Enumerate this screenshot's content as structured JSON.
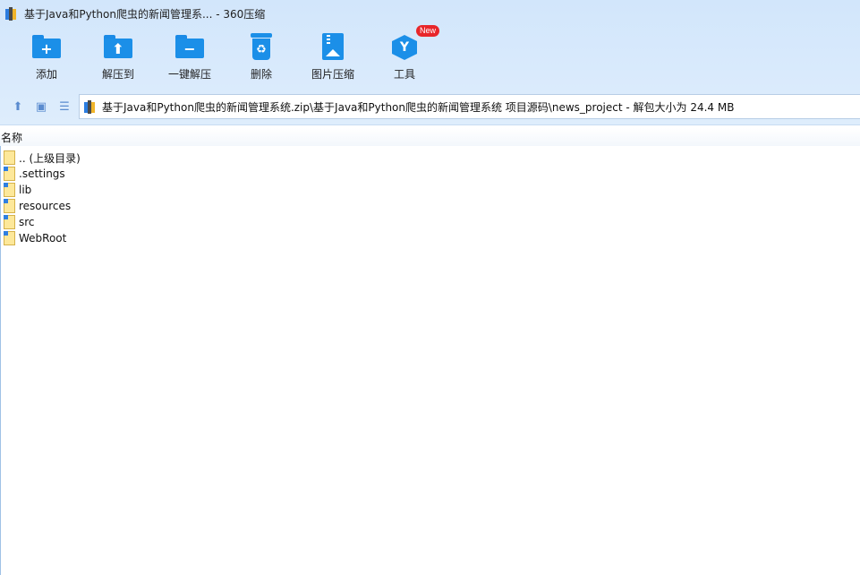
{
  "window": {
    "title": "基于Java和Python爬虫的新闻管理系... - 360压缩"
  },
  "toolbar": {
    "items": [
      {
        "label": "添加",
        "icon": "add-folder-icon"
      },
      {
        "label": "解压到",
        "icon": "extract-to-icon"
      },
      {
        "label": "一键解压",
        "icon": "one-click-extract-icon"
      },
      {
        "label": "删除",
        "icon": "recycle-bin-icon"
      },
      {
        "label": "图片压缩",
        "icon": "image-compress-icon"
      },
      {
        "label": "工具",
        "icon": "tools-icon",
        "badge": "New"
      }
    ]
  },
  "navbar": {
    "up_icon": "arrow-up-icon",
    "view_icon": "thumbnail-view-icon",
    "list_icon": "list-view-icon",
    "path": "基于Java和Python爬虫的新闻管理系统.zip\\基于Java和Python爬虫的新闻管理系统 项目源码\\news_project - 解包大小为 24.4 MB"
  },
  "columns": {
    "name": "名称"
  },
  "files": [
    {
      "name": ".. (上级目录)",
      "type": "parent"
    },
    {
      "name": ".settings",
      "type": "folder"
    },
    {
      "name": "lib",
      "type": "folder"
    },
    {
      "name": "resources",
      "type": "folder"
    },
    {
      "name": "src",
      "type": "folder"
    },
    {
      "name": "WebRoot",
      "type": "folder"
    }
  ],
  "colors": {
    "accent": "#1b8fe8",
    "header_bg": "#d6e8fb",
    "badge": "#e8262a"
  }
}
